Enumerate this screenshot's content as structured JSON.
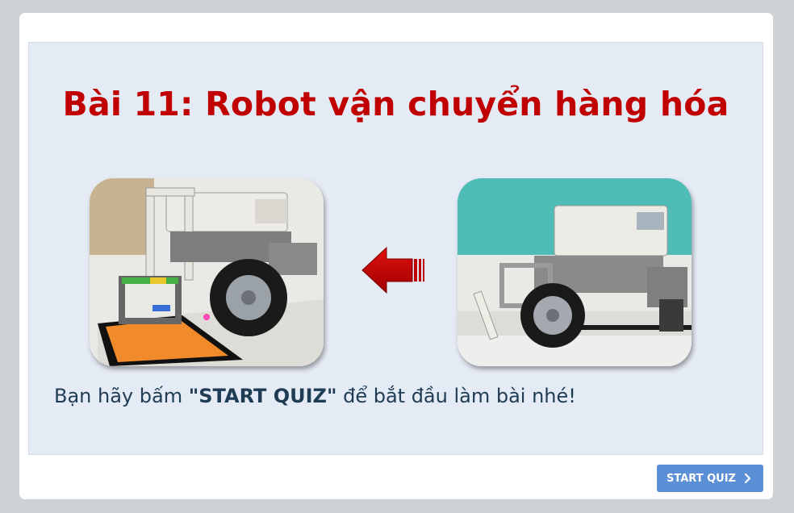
{
  "slide": {
    "title": "Bài 11: Robot vận chuyển hàng hóa",
    "instruction": {
      "before": "Bạn hãy bấm ",
      "emphasis": "\"START QUIZ\"",
      "after": " để bắt đầu làm bài nhé!"
    },
    "images": [
      {
        "name": "robot-carrying-cargo-photo",
        "icon": "robot-photo"
      },
      {
        "name": "robot-empty-photo",
        "icon": "robot-photo"
      }
    ],
    "arrow_icon": "left-arrow-icon"
  },
  "footer": {
    "start_quiz_label": "START QUIZ",
    "start_quiz_icon": "chevron-right-icon"
  },
  "colors": {
    "title": "#c00000",
    "slide_background": "#e5ebf5",
    "button": "#5b8fd6",
    "text": "#1f3c55"
  }
}
